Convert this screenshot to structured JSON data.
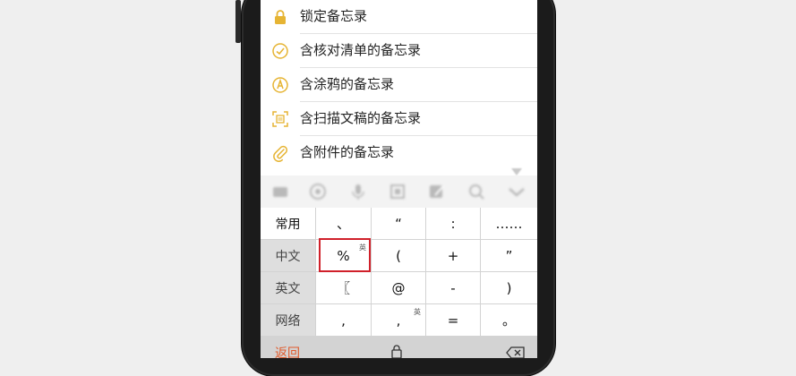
{
  "list": {
    "items": [
      {
        "label": "锁定备忘录",
        "icon": "lock-icon"
      },
      {
        "label": "含核对清单的备忘录",
        "icon": "check-circle-icon"
      },
      {
        "label": "含涂鸦的备忘录",
        "icon": "markup-pen-icon"
      },
      {
        "label": "含扫描文稿的备忘录",
        "icon": "scan-document-icon"
      },
      {
        "label": "含附件的备忘录",
        "icon": "paperclip-icon"
      }
    ]
  },
  "toolbar": {
    "icons": [
      "keyboard-icon",
      "emoji-icon",
      "microphone-icon",
      "grid-icon",
      "handwriting-icon",
      "search-icon",
      "collapse-icon"
    ]
  },
  "keyboard": {
    "side_keys": [
      "常用",
      "中文",
      "英文",
      "网络"
    ],
    "rows": [
      [
        "、",
        "“",
        ":",
        "……"
      ],
      [
        "%",
        "(",
        "+",
        "”"
      ],
      [
        "〖",
        "@",
        "-",
        ")"
      ],
      [
        ",",
        ",",
        "=",
        "。"
      ]
    ],
    "superscripts": {
      "percent_key": "英",
      "comma_key": "英"
    },
    "back_label": "返回"
  },
  "colors": {
    "accent": "#e6b433",
    "highlight": "#d0202a",
    "back": "#e05a2b"
  }
}
